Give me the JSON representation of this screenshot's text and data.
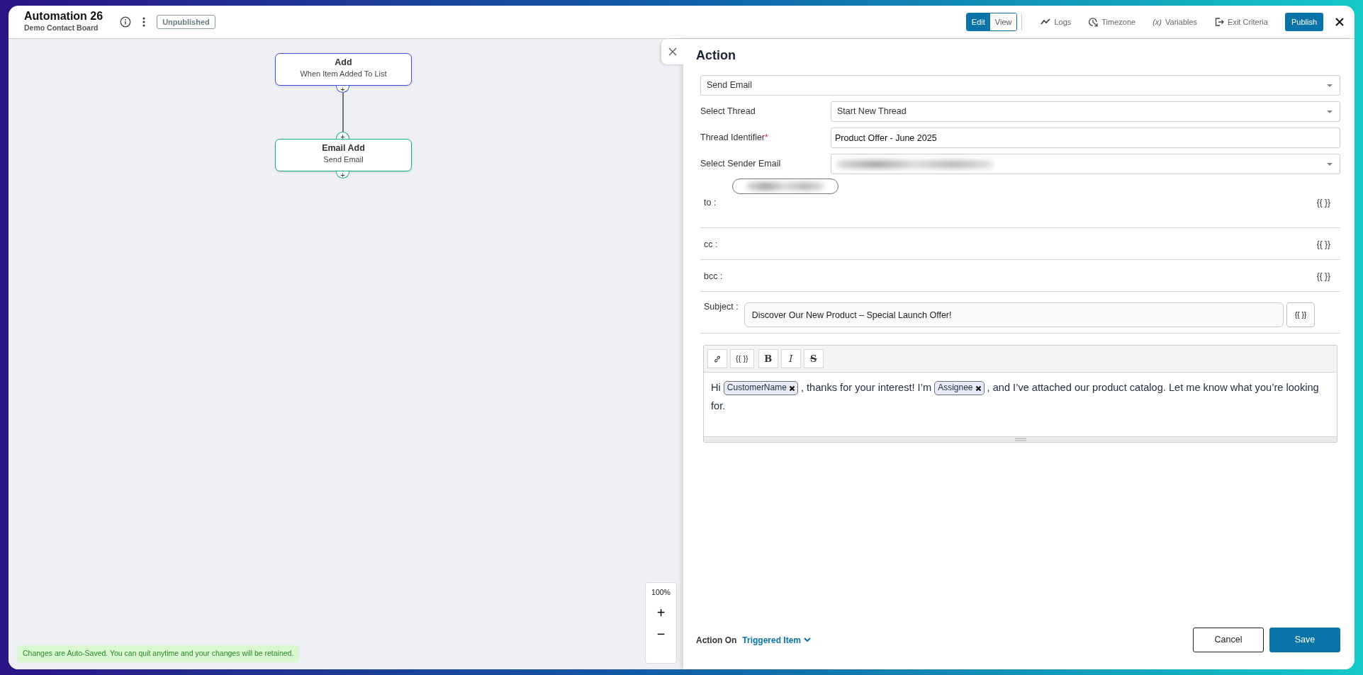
{
  "header": {
    "title": "Automation 26",
    "subtitle": "Demo Contact Board",
    "status_badge": "Unpublished",
    "mode_toggle": [
      {
        "label": "Edit",
        "selected": true
      },
      {
        "label": "View",
        "selected": false
      }
    ],
    "toolbar_links": [
      {
        "kind": "logs",
        "label": "Logs"
      },
      {
        "kind": "timezone",
        "label": "Timezone"
      },
      {
        "kind": "variables",
        "glyph": "(x)",
        "label": "Variables"
      },
      {
        "kind": "exit",
        "label": "Exit Criteria"
      }
    ],
    "publish_button": "Publish"
  },
  "canvas": {
    "nodes": [
      {
        "title": "Add",
        "subtitle": "When Item Added To List",
        "color": "#3f51d6"
      },
      {
        "title": "Email Add",
        "subtitle": "Send Email",
        "color": "#1aab8f"
      }
    ],
    "add_glyph": "+",
    "zoom": {
      "level": "100%",
      "zoom_in": "+",
      "zoom_out": "−"
    },
    "autosave_note": "Changes are Auto-Saved. You can quit anytime and your changes will be retained."
  },
  "panel": {
    "title": "Action",
    "action_select": "Send Email",
    "fields": [
      {
        "label": "Select Thread",
        "kind": "select",
        "required": false,
        "redacted": false,
        "value": "Start New Thread"
      },
      {
        "label": "Thread Identifier",
        "kind": "text",
        "required": true,
        "redacted": false,
        "value": "Product Offer - June 2025"
      },
      {
        "label": "Select Sender Email",
        "kind": "select",
        "required": false,
        "redacted": true
      }
    ],
    "required_mark": "*",
    "recipients": [
      {
        "label": "to :",
        "has_redacted_chip": true,
        "token_button": "{{ }}"
      },
      {
        "label": "cc :",
        "has_redacted_chip": false,
        "token_button": "{{ }}"
      },
      {
        "label": "bcc :",
        "has_redacted_chip": false,
        "token_button": "{{ }}"
      }
    ],
    "subject": {
      "label": "Subject :",
      "value": "Discover Our New Product – Special Launch Offer!",
      "token_button": "{{ }}"
    },
    "editor": {
      "toolbar": [
        {
          "kind": "link"
        },
        {
          "kind": "token",
          "text": "{{ }}"
        },
        {
          "kind": "bold",
          "text": "B"
        },
        {
          "kind": "italic",
          "text": "I"
        },
        {
          "kind": "strike",
          "text": "S"
        }
      ],
      "body_lines": [
        [
          {
            "kind": "text",
            "text": "Hi"
          },
          {
            "kind": "tag",
            "text": "CustomerName"
          },
          {
            "kind": "text",
            "text": ", thanks for your interest! I’m"
          },
          {
            "kind": "tag",
            "text": "Assignee"
          },
          {
            "kind": "text",
            "text": ", and I’ve attached our product catalog. Let me know what you’re looking"
          }
        ],
        [
          {
            "kind": "text",
            "text": "for."
          }
        ]
      ]
    },
    "footer": {
      "action_on_label": "Action On",
      "action_on_link": "Triggered Item",
      "buttons": [
        {
          "kind": "secondary",
          "label": "Cancel"
        },
        {
          "kind": "primary",
          "label": "Save"
        }
      ]
    }
  }
}
